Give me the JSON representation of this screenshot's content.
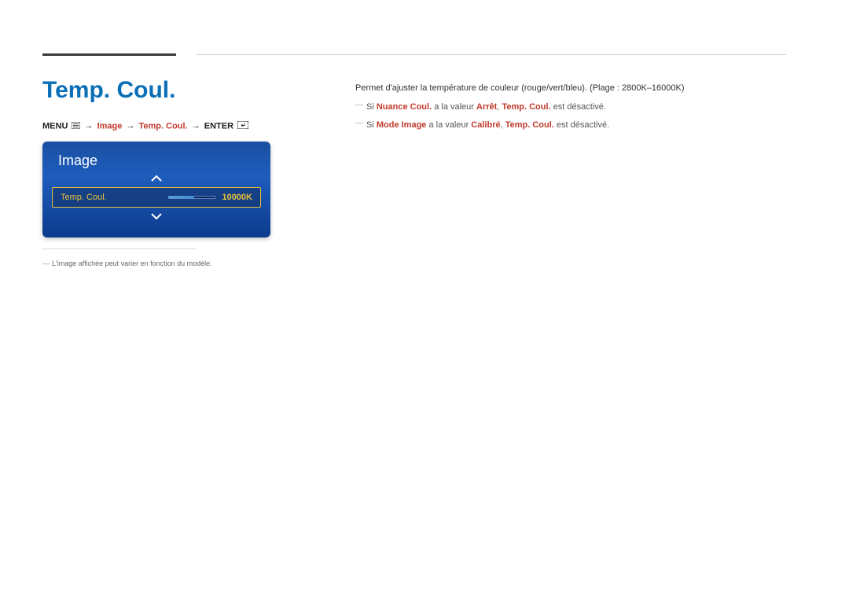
{
  "page": {
    "title": "Temp. Coul."
  },
  "breadcrumb": {
    "menu": "MENU",
    "image": "Image",
    "temp_coul": "Temp. Coul.",
    "enter": "ENTER"
  },
  "osd": {
    "title": "Image",
    "row_label": "Temp. Coul.",
    "value": "10000K",
    "slider_percent": 55
  },
  "footnote_left": "L'image affichée peut varier en fonction du modèle.",
  "description": {
    "intro": "Permet d'ajuster la température de couleur (rouge/vert/bleu). (Plage : 2800K–16000K)",
    "note1": {
      "pre": "Si ",
      "red1": "Nuance Coul.",
      "mid": " a la valeur ",
      "red2": "Arrêt",
      "sep": ", ",
      "red3": "Temp. Coul.",
      "post": " est désactivé."
    },
    "note2": {
      "pre": "Si ",
      "red1": "Mode Image",
      "mid": " a la valeur ",
      "red2": "Calibré",
      "sep": ", ",
      "red3": "Temp. Coul.",
      "post": " est désactivé."
    }
  }
}
